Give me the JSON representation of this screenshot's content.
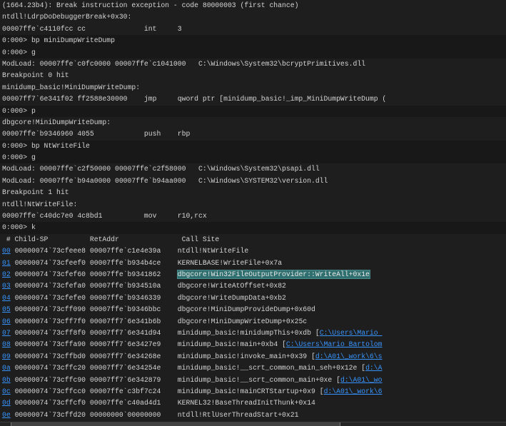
{
  "console_lines": [
    {
      "kind": "text",
      "text": "(1664.23b4): Break instruction exception - code 80000003 (first chance)"
    },
    {
      "kind": "text",
      "text": "ntdll!LdrpDoDebuggerBreak+0x30:"
    },
    {
      "kind": "text",
      "text": "00007ffe`c4110fcc cc              int     3"
    },
    {
      "kind": "prompt",
      "text": "0:000> bp miniDumpWriteDump"
    },
    {
      "kind": "prompt",
      "text": "0:000> g"
    },
    {
      "kind": "text",
      "text": "ModLoad: 00007ffe`c0fc0000 00007ffe`c1041000   C:\\Windows\\System32\\bcryptPrimitives.dll"
    },
    {
      "kind": "text",
      "text": "Breakpoint 0 hit"
    },
    {
      "kind": "text",
      "text": "minidump_basic!MiniDumpWriteDump:"
    },
    {
      "kind": "text",
      "text": "00007ff7`6e341f02 ff2588e30000    jmp     qword ptr [minidump_basic!_imp_MiniDumpWriteDump ("
    },
    {
      "kind": "prompt",
      "text": "0:000> p"
    },
    {
      "kind": "text",
      "text": "dbgcore!MiniDumpWriteDump:"
    },
    {
      "kind": "text",
      "text": "00007ffe`b9346960 4055            push    rbp"
    },
    {
      "kind": "prompt",
      "text": "0:000> bp NtWriteFile"
    },
    {
      "kind": "prompt",
      "text": "0:000> g"
    },
    {
      "kind": "text",
      "text": "ModLoad: 00007ffe`c2f50000 00007ffe`c2f58000   C:\\Windows\\System32\\psapi.dll"
    },
    {
      "kind": "text",
      "text": "ModLoad: 00007ffe`b94a0000 00007ffe`b94aa000   C:\\Windows\\SYSTEM32\\version.dll"
    },
    {
      "kind": "text",
      "text": "Breakpoint 1 hit"
    },
    {
      "kind": "text",
      "text": "ntdll!NtWriteFile:"
    },
    {
      "kind": "text",
      "text": "00007ffe`c40dc7e0 4c8bd1          mov     r10,rcx"
    },
    {
      "kind": "prompt",
      "text": "0:000> k"
    }
  ],
  "stack": {
    "header": " # Child-SP          RetAddr               Call Site",
    "frames": [
      {
        "num": "00",
        "child_sp": "00000074`73cfeee8",
        "ret_addr": "00007ffe`c1e4e39a",
        "call_site": "ntdll!NtWriteFile",
        "source": ""
      },
      {
        "num": "01",
        "child_sp": "00000074`73cfeef0",
        "ret_addr": "00007ffe`b934b4ce",
        "call_site": "KERNELBASE!WriteFile+0x7a",
        "source": ""
      },
      {
        "num": "02",
        "child_sp": "00000074`73cfef60",
        "ret_addr": "00007ffe`b9341862",
        "call_site": "dbgcore!Win32FileOutputProvider::WriteAll+0x1e",
        "source": "",
        "selected": true
      },
      {
        "num": "03",
        "child_sp": "00000074`73cfefa0",
        "ret_addr": "00007ffe`b934510a",
        "call_site": "dbgcore!WriteAtOffset+0x82",
        "source": ""
      },
      {
        "num": "04",
        "child_sp": "00000074`73cfefe0",
        "ret_addr": "00007ffe`b9346339",
        "call_site": "dbgcore!WriteDumpData+0xb2",
        "source": ""
      },
      {
        "num": "05",
        "child_sp": "00000074`73cff090",
        "ret_addr": "00007ffe`b9346bbc",
        "call_site": "dbgcore!MiniDumpProvideDump+0x60d",
        "source": ""
      },
      {
        "num": "06",
        "child_sp": "00000074`73cff7f0",
        "ret_addr": "00007ff7`6e341b6b",
        "call_site": "dbgcore!MiniDumpWriteDump+0x25c",
        "source": ""
      },
      {
        "num": "07",
        "child_sp": "00000074`73cff8f0",
        "ret_addr": "00007ff7`6e341d94",
        "call_site": "minidump_basic!minidumpThis+0xdb ",
        "source": "C:\\Users\\Mario "
      },
      {
        "num": "08",
        "child_sp": "00000074`73cffa90",
        "ret_addr": "00007ff7`6e3427e9",
        "call_site": "minidump_basic!main+0xb4 ",
        "source": "C:\\Users\\Mario Bartolom"
      },
      {
        "num": "09",
        "child_sp": "00000074`73cffbd0",
        "ret_addr": "00007ff7`6e34268e",
        "call_site": "minidump_basic!invoke_main+0x39 ",
        "source": "d:\\A01\\_work\\6\\s"
      },
      {
        "num": "0a",
        "child_sp": "00000074`73cffc20",
        "ret_addr": "00007ff7`6e34254e",
        "call_site": "minidump_basic!__scrt_common_main_seh+0x12e ",
        "source": "d:\\A"
      },
      {
        "num": "0b",
        "child_sp": "00000074`73cffc90",
        "ret_addr": "00007ff7`6e342879",
        "call_site": "minidump_basic!__scrt_common_main+0xe ",
        "source": "d:\\A01\\_wo"
      },
      {
        "num": "0c",
        "child_sp": "00000074`73cffcc0",
        "ret_addr": "00007ffe`c3bf7c24",
        "call_site": "minidump_basic!mainCRTStartup+0x9 ",
        "source": "d:\\A01\\_work\\6"
      },
      {
        "num": "0d",
        "child_sp": "00000074`73cffcf0",
        "ret_addr": "00007ffe`c40ad4d1",
        "call_site": "KERNEL32!BaseThreadInitThunk+0x14",
        "source": ""
      },
      {
        "num": "0e",
        "child_sp": "00000074`73cffd20",
        "ret_addr": "00000000`00000000",
        "call_site": "ntdll!RtlUserThreadStart+0x21",
        "source": ""
      }
    ]
  },
  "colors": {
    "background": "#1e1e1e",
    "link": "#3794ff",
    "selection": "#2f6f6f"
  }
}
